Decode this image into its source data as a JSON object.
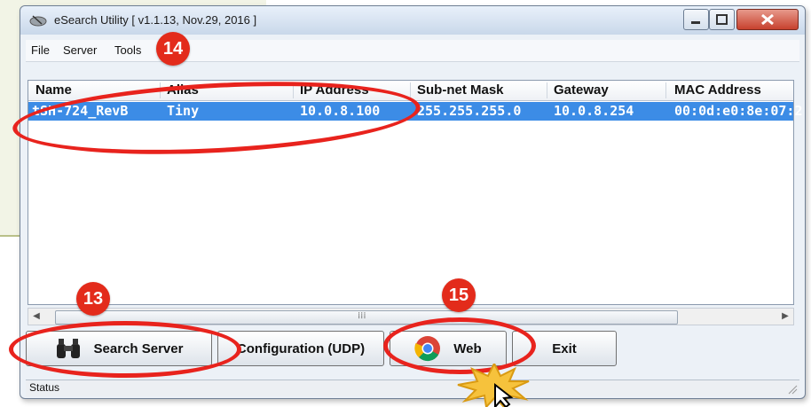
{
  "window": {
    "title": "eSearch Utility [ v1.1.13, Nov.29, 2016 ]"
  },
  "menu": [
    "File",
    "Server",
    "Tools"
  ],
  "table": {
    "columns": [
      "Name",
      "Alias",
      "IP Address",
      "Sub-net Mask",
      "Gateway",
      "MAC Address"
    ],
    "rows": [
      [
        "tSH-724_RevB",
        "Tiny",
        "10.0.8.100",
        "255.255.255.0",
        "10.0.8.254",
        "00:0d:e0:8e:07:2"
      ]
    ]
  },
  "buttons": {
    "search": "Search Server",
    "config": "Configuration (UDP)",
    "web": "Web",
    "exit": "Exit"
  },
  "status": "Status",
  "annotations": {
    "step_search": "13",
    "step_row": "14",
    "step_web": "15"
  },
  "colors": {
    "selection": "#3c8ce6",
    "annotation": "#e32b1b"
  }
}
